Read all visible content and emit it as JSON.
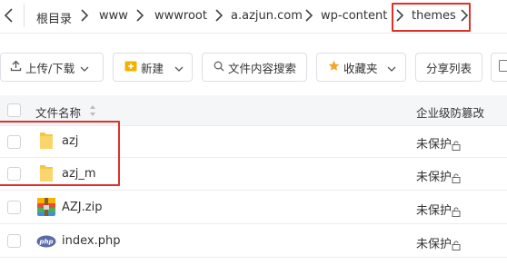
{
  "breadcrumb": {
    "items": [
      "根目录",
      "www",
      "wwwroot",
      "a.azjun.com",
      "wp-content",
      "themes"
    ]
  },
  "toolbar": {
    "upload_label": "上传/下载",
    "new_label": "新建",
    "search_label": "文件内容搜索",
    "favorites_label": "收藏夹",
    "share_label": "分享列表"
  },
  "table": {
    "columns": {
      "name": "文件名称",
      "protect": "企业级防篡改"
    },
    "rows": [
      {
        "name": "azj",
        "type": "folder",
        "status": "未保护"
      },
      {
        "name": "azj_m",
        "type": "folder",
        "status": "未保护"
      },
      {
        "name": "AZJ.zip",
        "type": "zip",
        "status": "未保护"
      },
      {
        "name": "index.php",
        "type": "php",
        "status": "未保护"
      }
    ]
  },
  "colors": {
    "highlight": "#e0302a",
    "folder": "#f6c543",
    "star": "#f4a62a",
    "new_icon": "#f0b400"
  },
  "icons": {
    "php_badge": "php"
  }
}
